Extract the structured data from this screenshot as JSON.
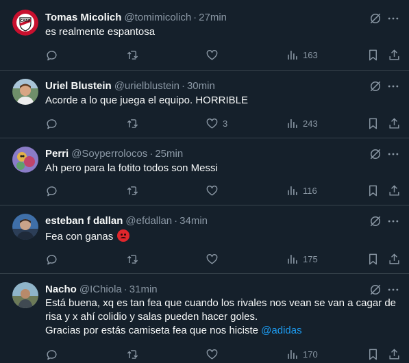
{
  "colors": {
    "background": "#15202b",
    "divider": "#38444d",
    "text": "#f7f9f9",
    "muted": "#8b98a5",
    "accent": "#1d9bf0"
  },
  "tweets": [
    {
      "name": "Tomas Micolich",
      "handle": "@tomimicolich",
      "time": "27min",
      "lines": [
        "es realmente espantosa"
      ],
      "replies": "",
      "retweets": "",
      "likes": "",
      "views": "163"
    },
    {
      "name": "Uriel Blustein",
      "handle": "@urielblustein",
      "time": "30min",
      "lines": [
        "Acorde a lo que juega el equipo. HORRIBLE"
      ],
      "replies": "",
      "retweets": "",
      "likes": "3",
      "views": "243"
    },
    {
      "name": "Perri",
      "handle": "@Soyperrolocos",
      "time": "25min",
      "lines": [
        "Ah pero para la fotito todos son Messi"
      ],
      "replies": "",
      "retweets": "",
      "likes": "",
      "views": "116"
    },
    {
      "name": "esteban f dallan",
      "handle": "@efdallan",
      "time": "34min",
      "lines": [
        "Fea con ganas"
      ],
      "emoji": "angry-face-emoji",
      "replies": "",
      "retweets": "",
      "likes": "",
      "views": "175"
    },
    {
      "name": "Nacho",
      "handle": "@IChiola",
      "time": "31min",
      "lines": [
        "Está buena, xq es tan fea que cuando los rivales nos vean se van a cagar de",
        "risa y x ahí colidio y salas pueden hacer goles.",
        "Gracias por estás camiseta fea que nos hiciste"
      ],
      "mention": "@adidas",
      "replies": "",
      "retweets": "",
      "likes": "",
      "views": "170"
    }
  ],
  "icons": {
    "reply": "reply-icon",
    "retweet": "retweet-icon",
    "like": "like-icon",
    "views": "views-icon",
    "bookmark": "bookmark-icon",
    "share": "share-icon",
    "grok": "grok-icon",
    "more": "more-icon"
  }
}
